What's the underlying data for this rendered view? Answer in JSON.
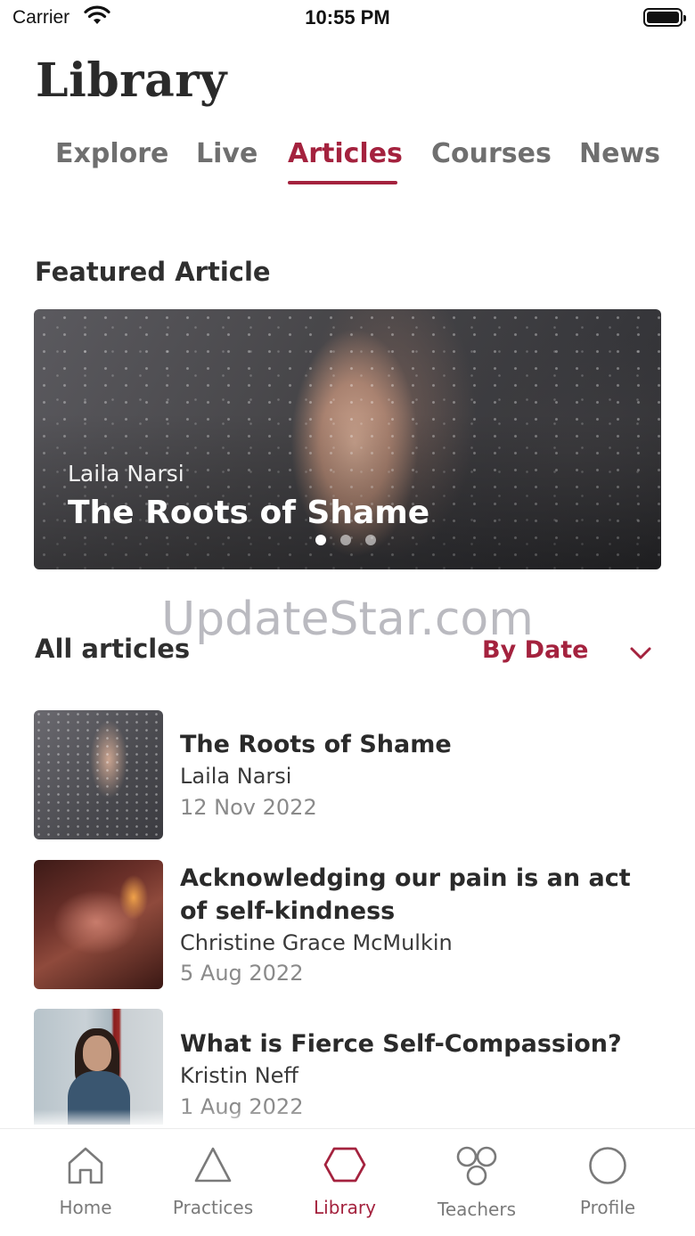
{
  "status_bar": {
    "carrier": "Carrier",
    "time": "10:55 PM"
  },
  "header": {
    "title": "Library"
  },
  "tabs": [
    {
      "label": "Explore",
      "active": false
    },
    {
      "label": "Live",
      "active": false
    },
    {
      "label": "Articles",
      "active": true
    },
    {
      "label": "Courses",
      "active": false
    },
    {
      "label": "News",
      "active": false
    }
  ],
  "featured": {
    "section_title": "Featured Article",
    "author": "Laila Narsi",
    "title": "The Roots of Shame",
    "pages": 3,
    "current_page": 1
  },
  "watermark": "UpdateStar.com",
  "all_articles": {
    "section_title": "All articles",
    "sort_label": "By Date",
    "items": [
      {
        "title": "The Roots of Shame",
        "author": "Laila Narsi",
        "date": "12 Nov 2022"
      },
      {
        "title": "Acknowledging our pain is an act of self-kindness",
        "author": "Christine Grace McMulkin",
        "date": "5 Aug 2022"
      },
      {
        "title": "What is Fierce Self-Compassion?",
        "author": "Kristin Neff",
        "date": "1 Aug 2022"
      }
    ]
  },
  "tab_bar": {
    "items": [
      {
        "label": "Home",
        "icon": "home-icon",
        "active": false
      },
      {
        "label": "Practices",
        "icon": "triangle-icon",
        "active": false
      },
      {
        "label": "Library",
        "icon": "hexagon-icon",
        "active": true
      },
      {
        "label": "Teachers",
        "icon": "teachers-icon",
        "active": false
      },
      {
        "label": "Profile",
        "icon": "circle-icon",
        "active": false
      }
    ]
  },
  "colors": {
    "accent": "#a4223e",
    "inactive": "#7a7a7a",
    "text": "#2b2b2b"
  }
}
